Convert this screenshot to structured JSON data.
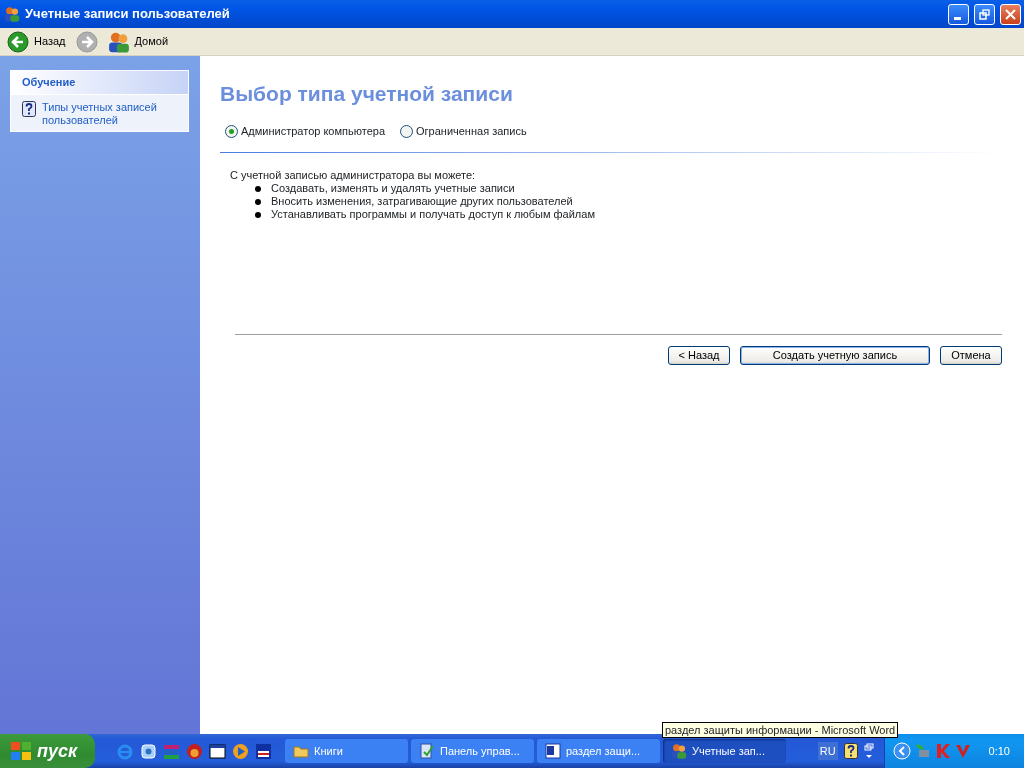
{
  "window": {
    "title": "Учетные записи пользователей"
  },
  "toolbar": [
    {
      "kind": "back",
      "label": "Назад",
      "disabled": false
    },
    {
      "kind": "forward",
      "disabled": true
    },
    {
      "kind": "home",
      "label": "Домой",
      "disabled": false
    }
  ],
  "sidebar": {
    "panel_title": "Обучение",
    "links": [
      "Типы учетных записей пользователей"
    ]
  },
  "content": {
    "heading": "Выбор типа учетной записи",
    "options": [
      {
        "label": "Администратор компьютера",
        "selected": true
      },
      {
        "label": "Ограниченная запись",
        "selected": false
      }
    ],
    "description": "С учетной записью администратора вы можете:",
    "bullets": [
      "Создавать, изменять и удалять учетные записи",
      "Вносить изменения, затрагивающие других пользователей",
      "Устанавливать программы и получать доступ к любым файлам"
    ],
    "buttons": [
      {
        "label": "< Назад",
        "kind": "normal"
      },
      {
        "label": "Создать учетную запись",
        "kind": "default"
      },
      {
        "label": "Отмена",
        "kind": "normal"
      }
    ]
  },
  "tooltip": "раздел защиты информации - Microsoft Word",
  "taskbar": {
    "start": "пуск",
    "tasks": [
      {
        "label": "Книги",
        "kind": "folder",
        "selected": false
      },
      {
        "label": "Панель управ...",
        "kind": "control",
        "selected": false
      },
      {
        "label": "раздел защи...",
        "kind": "word",
        "selected": false
      },
      {
        "label": "Учетные зап...",
        "kind": "users",
        "selected": true
      }
    ],
    "language": "RU",
    "clock": "0:10"
  }
}
